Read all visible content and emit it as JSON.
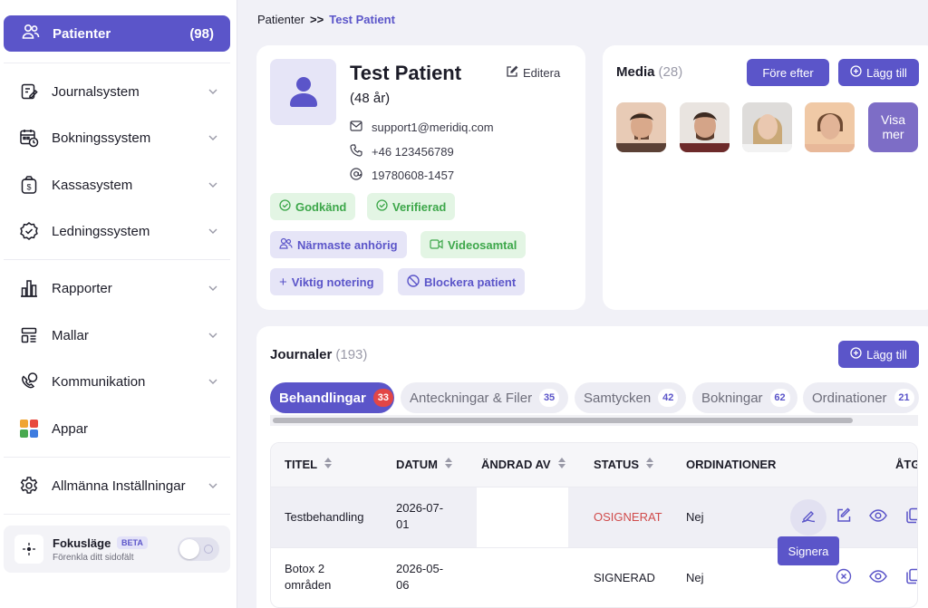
{
  "colors": {
    "accent": "#5b55c9",
    "success": "#3da74a",
    "danger": "#e24646",
    "unsigned": "#d04b4b"
  },
  "sidebar": {
    "active": {
      "label": "Patienter",
      "count": "(98)",
      "icon": "users-icon"
    },
    "items": [
      {
        "label": "Journalsystem",
        "icon": "journal-edit-icon"
      },
      {
        "label": "Bokningssystem",
        "icon": "calendar-clock-icon"
      },
      {
        "label": "Kassasystem",
        "icon": "money-bag-icon"
      },
      {
        "label": "Ledningssystem",
        "icon": "badge-check-icon"
      },
      {
        "label": "Rapporter",
        "icon": "bar-chart-icon"
      },
      {
        "label": "Mallar",
        "icon": "template-icon"
      },
      {
        "label": "Kommunikation",
        "icon": "phone-chat-icon"
      },
      {
        "label": "Appar",
        "icon": "apps-grid-icon"
      },
      {
        "label": "Allmänna Inställningar",
        "icon": "gear-icon"
      }
    ],
    "focus": {
      "title": "Fokusläge",
      "badge": "BETA",
      "subtitle": "Förenkla ditt sidofält",
      "enabled": false
    }
  },
  "breadcrumb": {
    "parent": "Patienter",
    "separator": ">>",
    "current": "Test Patient"
  },
  "patient": {
    "name": "Test Patient",
    "age": "(48 år)",
    "edit_label": "Editera",
    "email": "support1@meridiq.com",
    "phone": "+46 123456789",
    "personal_number": "19780608-1457",
    "chips": [
      "Godkänd",
      "Verifierad",
      "Närmaste anhörig",
      "Videosamtal",
      "Viktig notering",
      "Blockera patient"
    ]
  },
  "media": {
    "title": "Media",
    "count": "(28)",
    "before_after_label": "Före efter",
    "add_label": "Lägg till",
    "show_more_label": "Visa mer"
  },
  "journals": {
    "title": "Journaler",
    "count": "(193)",
    "add_label": "Lägg till",
    "tabs": [
      {
        "label": "Behandlingar",
        "count": "33"
      },
      {
        "label": "Anteckningar & Filer",
        "count": "35"
      },
      {
        "label": "Samtycken",
        "count": "42"
      },
      {
        "label": "Bokningar",
        "count": "62"
      },
      {
        "label": "Ordinationer",
        "count": "21"
      }
    ],
    "columns": [
      "TITEL",
      "DATUM",
      "ÄNDRAD AV",
      "STATUS",
      "ORDINATIONER",
      "ÅTG"
    ],
    "rows": [
      {
        "title": "Testbehandling",
        "date_line1": "2026-07-",
        "date_line2": "01",
        "status": "OSIGNERAT",
        "prescriptions": "Nej"
      },
      {
        "title_line1": "Botox 2",
        "title_line2": "områden",
        "date_line1": "2026-05-",
        "date_line2": "06",
        "status": "SIGNERAD",
        "prescriptions": "Nej"
      }
    ],
    "tooltip": "Signera"
  }
}
